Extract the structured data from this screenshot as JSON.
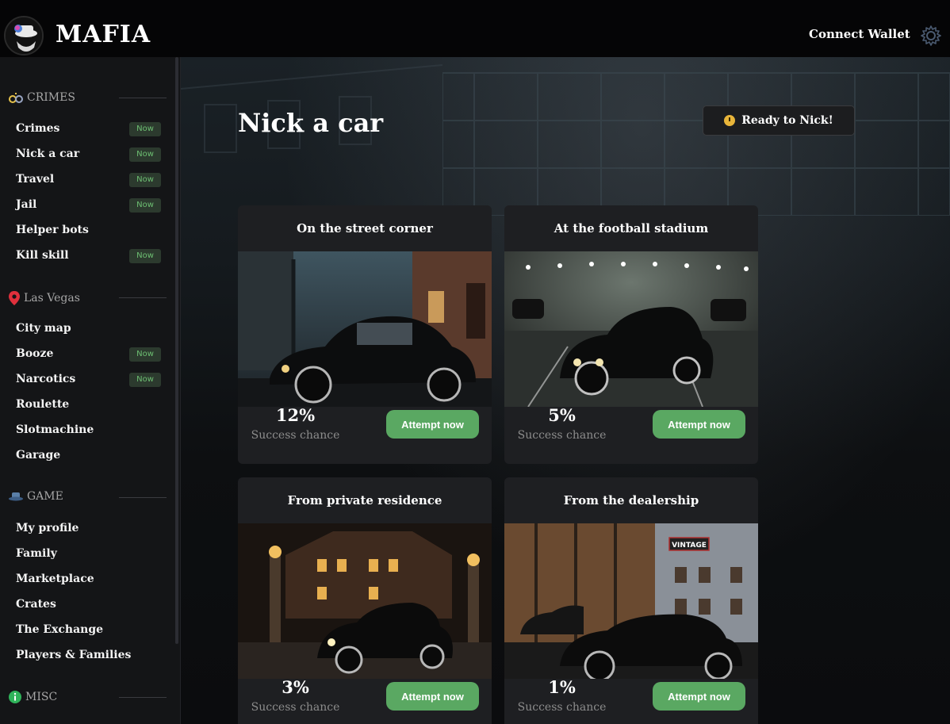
{
  "app": {
    "title": "MAFIA",
    "connect_wallet": "Connect Wallet"
  },
  "sidebar": {
    "sections": [
      {
        "label": "CRIMES",
        "icon": "handcuffs-icon"
      },
      {
        "label": "Las Vegas",
        "icon": "map-pin-icon"
      },
      {
        "label": "GAME",
        "icon": "hat-icon"
      },
      {
        "label": "MISC",
        "icon": "info-icon"
      }
    ],
    "crimes": [
      {
        "label": "Crimes",
        "badge": "Now"
      },
      {
        "label": "Nick a car",
        "badge": "Now"
      },
      {
        "label": "Travel",
        "badge": "Now"
      },
      {
        "label": "Jail",
        "badge": "Now"
      },
      {
        "label": "Helper bots",
        "badge": ""
      },
      {
        "label": "Kill skill",
        "badge": "Now"
      }
    ],
    "vegas": [
      {
        "label": "City map",
        "badge": ""
      },
      {
        "label": "Booze",
        "badge": "Now"
      },
      {
        "label": "Narcotics",
        "badge": "Now"
      },
      {
        "label": "Roulette",
        "badge": ""
      },
      {
        "label": "Slotmachine",
        "badge": ""
      },
      {
        "label": "Garage",
        "badge": ""
      }
    ],
    "game": [
      {
        "label": "My profile"
      },
      {
        "label": "Family"
      },
      {
        "label": "Marketplace"
      },
      {
        "label": "Crates"
      },
      {
        "label": "The Exchange"
      },
      {
        "label": "Players & Families"
      }
    ]
  },
  "main": {
    "title": "Nick a car",
    "ready_label": "Ready to Nick!",
    "cards": [
      {
        "title": "On the street corner",
        "percent": "12%",
        "chance_label": "Success chance",
        "button": "Attempt now"
      },
      {
        "title": "At the football stadium",
        "percent": "5%",
        "chance_label": "Success chance",
        "button": "Attempt now"
      },
      {
        "title": "From private residence",
        "percent": "3%",
        "chance_label": "Success chance",
        "button": "Attempt now"
      },
      {
        "title": "From the dealership",
        "percent": "1%",
        "chance_label": "Success chance",
        "button": "Attempt now"
      }
    ],
    "dealership_sign": "VINTAGE"
  },
  "colors": {
    "accent_green": "#5aa862",
    "badge_text": "#6dbf72",
    "badge_bg": "#2c3a2e"
  }
}
